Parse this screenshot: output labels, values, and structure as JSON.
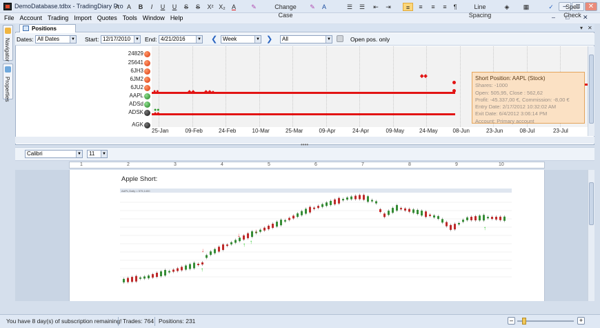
{
  "window": {
    "title": "DemoDatabase.tdbx - TradingDiary Pro",
    "controls": {
      "minimize": "–",
      "restore": "□",
      "close": "✕"
    }
  },
  "menu": {
    "items": [
      "File",
      "Account",
      "Trading",
      "Import",
      "Quotes",
      "Tools",
      "Window",
      "Help"
    ]
  },
  "sidebar": {
    "navigator": "Navigator",
    "properties": "Properties"
  },
  "panel": {
    "tab_label": "Positions (Gantt)",
    "pin": "▾",
    "close": "✕",
    "filters": {
      "dates_label": "Dates:",
      "dates_value": "All Dates",
      "start_label": "Start:",
      "start_value": "12/17/2010",
      "end_label": "End:",
      "end_value": "4/21/2016",
      "period_value": "Week",
      "scope_value": "All",
      "open_only": "Open pos. only"
    }
  },
  "gantt": {
    "rows": [
      {
        "symbol": "24829",
        "status": "red"
      },
      {
        "symbol": "25641",
        "status": "red"
      },
      {
        "symbol": "6JH3",
        "status": "red"
      },
      {
        "symbol": "6JM2",
        "status": "red"
      },
      {
        "symbol": "6JU2",
        "status": "red"
      },
      {
        "symbol": "AAPL",
        "status": "green"
      },
      {
        "symbol": "ADSd",
        "status": "green"
      },
      {
        "symbol": "ADSK",
        "status": "dark"
      },
      {
        "symbol": "AGK",
        "status": "dark"
      }
    ],
    "axis_ticks": [
      "25-Jan",
      "09-Feb",
      "24-Feb",
      "10-Mar",
      "25-Mar",
      "09-Apr",
      "24-Apr",
      "09-May",
      "24-May",
      "08-Jun",
      "23-Jun",
      "08-Jul",
      "23-Jul"
    ],
    "tooltip": {
      "title": "Short Position: AAPL (Stock)",
      "lines": [
        "Shares: -1000",
        "Open: 505,95, Close : 562,62",
        "Profit: -45.337,00 €, Commission: -8,00 €",
        "Entry Date: 2/17/2012 10:32:02 AM",
        "Exit Date: 6/4/2012 3:06:14 PM",
        "Account: Primary account"
      ]
    }
  },
  "format_toolbar": {
    "font_family": "Calibri",
    "font_size": "11",
    "change_case": "Change Case",
    "line_spacing": "Line Spacing",
    "spell_check": "Spell Check"
  },
  "ruler": {
    "numbers": [
      "1",
      "2",
      "3",
      "4",
      "5",
      "6",
      "7",
      "8",
      "9",
      "10"
    ]
  },
  "document": {
    "heading": "Apple Short:",
    "chart_caption": "AAPL,Daily = 575,1400"
  },
  "status": {
    "subscription": "You have 8 day(s) of subscription remaining!",
    "trades": "Trades: 764",
    "positions": "Positions: 231"
  },
  "colors": {
    "accent": "#e21414",
    "tooltip_bg": "#fbe1c4",
    "up": "#2e9a2e",
    "down": "#d92020"
  }
}
